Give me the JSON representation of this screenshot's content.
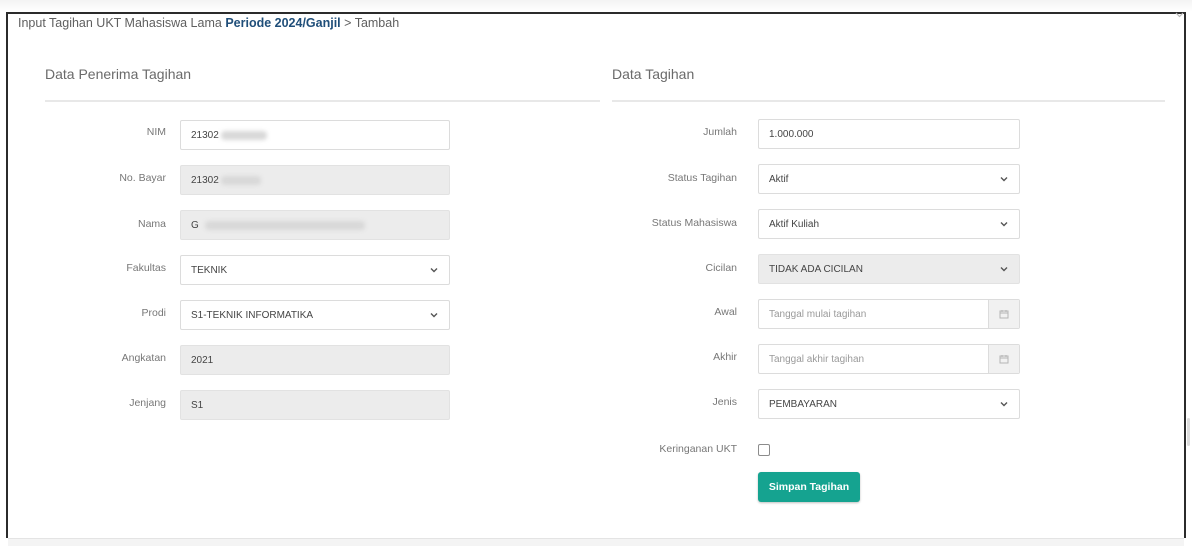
{
  "breadcrumb": {
    "prefix": "Input Tagihan UKT Mahasiswa Lama",
    "period": "Periode 2024/Ganjil",
    "suffix": "> Tambah"
  },
  "penerima": {
    "title": "Data Penerima Tagihan",
    "nim": {
      "label": "NIM",
      "value": "21302"
    },
    "no_bayar": {
      "label": "No. Bayar",
      "value": "21302"
    },
    "nama": {
      "label": "Nama",
      "value": "G"
    },
    "fakultas": {
      "label": "Fakultas",
      "value": "TEKNIK"
    },
    "prodi": {
      "label": "Prodi",
      "value": "S1-TEKNIK INFORMATIKA"
    },
    "angkatan": {
      "label": "Angkatan",
      "value": "2021"
    },
    "jenjang": {
      "label": "Jenjang",
      "value": "S1"
    }
  },
  "tagihan": {
    "title": "Data Tagihan",
    "jumlah": {
      "label": "Jumlah",
      "value": "1.000.000"
    },
    "status_tagihan": {
      "label": "Status Tagihan",
      "value": "Aktif"
    },
    "status_mahasiswa": {
      "label": "Status Mahasiswa",
      "value": "Aktif Kuliah"
    },
    "cicilan": {
      "label": "Cicilan",
      "value": "TIDAK ADA CICILAN"
    },
    "awal": {
      "label": "Awal",
      "placeholder": "Tanggal mulai tagihan"
    },
    "akhir": {
      "label": "Akhir",
      "placeholder": "Tanggal akhir tagihan"
    },
    "jenis": {
      "label": "Jenis",
      "value": "PEMBAYARAN"
    },
    "keringanan": {
      "label": "Keringanan UKT",
      "checked": false
    },
    "submit_label": "Simpan Tagihan"
  },
  "colors": {
    "accent": "#15a390",
    "period_link": "#1f4e79",
    "readonly_bg": "#ececec"
  },
  "icons": {
    "select": "chevron-down-icon",
    "date": "calendar-icon",
    "collapse": "chevron-down-icon"
  }
}
